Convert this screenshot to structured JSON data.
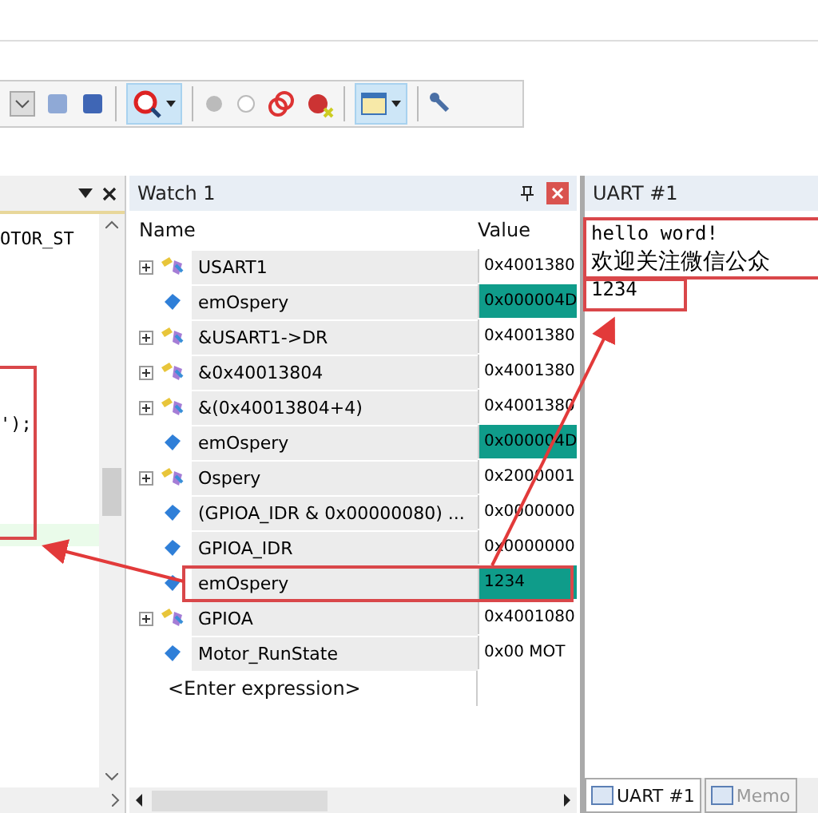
{
  "code_lines": [
    "OTOR_ST",
    "');"
  ],
  "watch": {
    "title": "Watch 1",
    "columns": [
      "Name",
      "Value"
    ],
    "rows": [
      {
        "kind": "struct",
        "name": "USART1",
        "value": "0x4001380",
        "changed": false
      },
      {
        "kind": "var",
        "name": "emOspery",
        "value": "0x000004D",
        "changed": true
      },
      {
        "kind": "struct",
        "name": "&USART1->DR",
        "value": "0x4001380",
        "changed": false
      },
      {
        "kind": "struct",
        "name": "&0x40013804",
        "value": "0x4001380",
        "changed": false
      },
      {
        "kind": "struct",
        "name": "&(0x40013804+4)",
        "value": "0x4001380",
        "changed": false
      },
      {
        "kind": "var",
        "name": "emOspery",
        "value": "0x000004D",
        "changed": true
      },
      {
        "kind": "struct",
        "name": "Ospery",
        "value": "0x2000001",
        "changed": false
      },
      {
        "kind": "var",
        "name": "(GPIOA_IDR & 0x00000080) ...",
        "value": "0x0000000",
        "changed": false
      },
      {
        "kind": "var",
        "name": "GPIOA_IDR",
        "value": "0x0000000",
        "changed": false
      },
      {
        "kind": "var",
        "name": "emOspery",
        "value": "1234",
        "changed": true
      },
      {
        "kind": "struct",
        "name": "GPIOA",
        "value": "0x4001080",
        "changed": false
      },
      {
        "kind": "var",
        "name": "Motor_RunState",
        "value": "0x00 MOT",
        "changed": false
      }
    ],
    "placeholder": "<Enter expression>"
  },
  "uart": {
    "title": "UART #1",
    "lines": [
      "hello word!",
      "欢迎关注微信公众",
      "1234"
    ]
  },
  "bottom_tabs": [
    {
      "label": "UART #1",
      "selected": true
    },
    {
      "label": "Memo",
      "selected": false
    }
  ]
}
